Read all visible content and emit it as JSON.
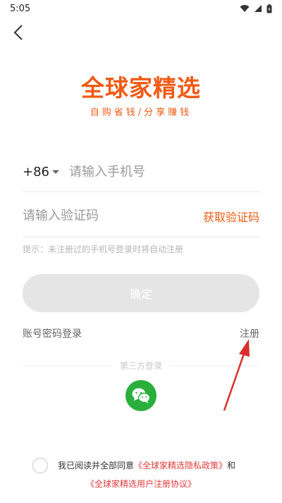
{
  "status_bar": {
    "time": "5:05"
  },
  "logo": {
    "title": "全球家精选",
    "slogan": "自购省钱/分享赚钱"
  },
  "phone": {
    "country_code": "+86",
    "placeholder": "请输入手机号"
  },
  "code": {
    "placeholder": "请输入验证码",
    "get_code_label": "获取验证码"
  },
  "hint": "提示：未注册过的手机号登录时将自动注册",
  "confirm_label": "确定",
  "account_login_label": "账号密码登录",
  "register_label": "注册",
  "third_party_label": "第三方登录",
  "agreement": {
    "prefix": "我已阅读并全部同意",
    "privacy_link": "《全球家精选隐私政策》",
    "and": "和",
    "terms_link": "《全球家精选用户注册协议》"
  },
  "colors": {
    "brand": "#f05a14",
    "wechat": "#2aae3c",
    "link": "#e23b3b",
    "annotation_arrow": "#d9302c"
  }
}
